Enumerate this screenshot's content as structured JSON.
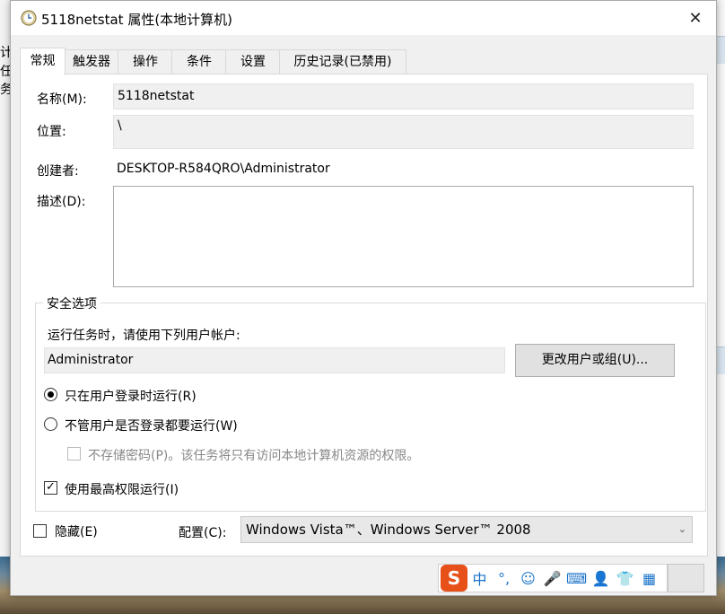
{
  "background": {
    "left_texts": [
      "计",
      "任务"
    ]
  },
  "window": {
    "title": "5118netstat 属性(本地计算机)",
    "close_glyph": "✕"
  },
  "tabs": [
    {
      "label": "常规",
      "active": true
    },
    {
      "label": "触发器",
      "active": false
    },
    {
      "label": "操作",
      "active": false
    },
    {
      "label": "条件",
      "active": false
    },
    {
      "label": "设置",
      "active": false
    },
    {
      "label": "历史记录(已禁用)",
      "active": false
    }
  ],
  "general": {
    "name_label": "名称(M):",
    "name_value": "5118netstat",
    "location_label": "位置:",
    "location_value": "\\",
    "author_label": "创建者:",
    "author_value": "DESKTOP-R584QRO\\Administrator",
    "description_label": "描述(D):",
    "description_value": ""
  },
  "security": {
    "group_title": "安全选项",
    "run_as_text": "运行任务时，请使用下列用户帐户:",
    "user_account": "Administrator",
    "change_user_button": "更改用户或组(U)...",
    "radio_logged_on": "只在用户登录时运行(R)",
    "radio_logged_on_selected": true,
    "radio_whether_logged": "不管用户是否登录都要运行(W)",
    "radio_whether_logged_selected": false,
    "do_not_store_password": "不存储密码(P)。该任务将只有访问本地计算机资源的权限。",
    "do_not_store_password_checked": false,
    "highest_privileges": "使用最高权限运行(I)",
    "highest_privileges_checked": true
  },
  "footer": {
    "hidden_label": "隐藏(E)",
    "hidden_checked": false,
    "configure_label": "配置(C):",
    "configure_value": "Windows Vista™、Windows Server™ 2008"
  },
  "ime_toolbar": {
    "logo": "S",
    "items": [
      "中",
      "°,",
      "☺",
      "🎤",
      "⌨",
      "👤",
      "👕",
      "▦"
    ]
  }
}
